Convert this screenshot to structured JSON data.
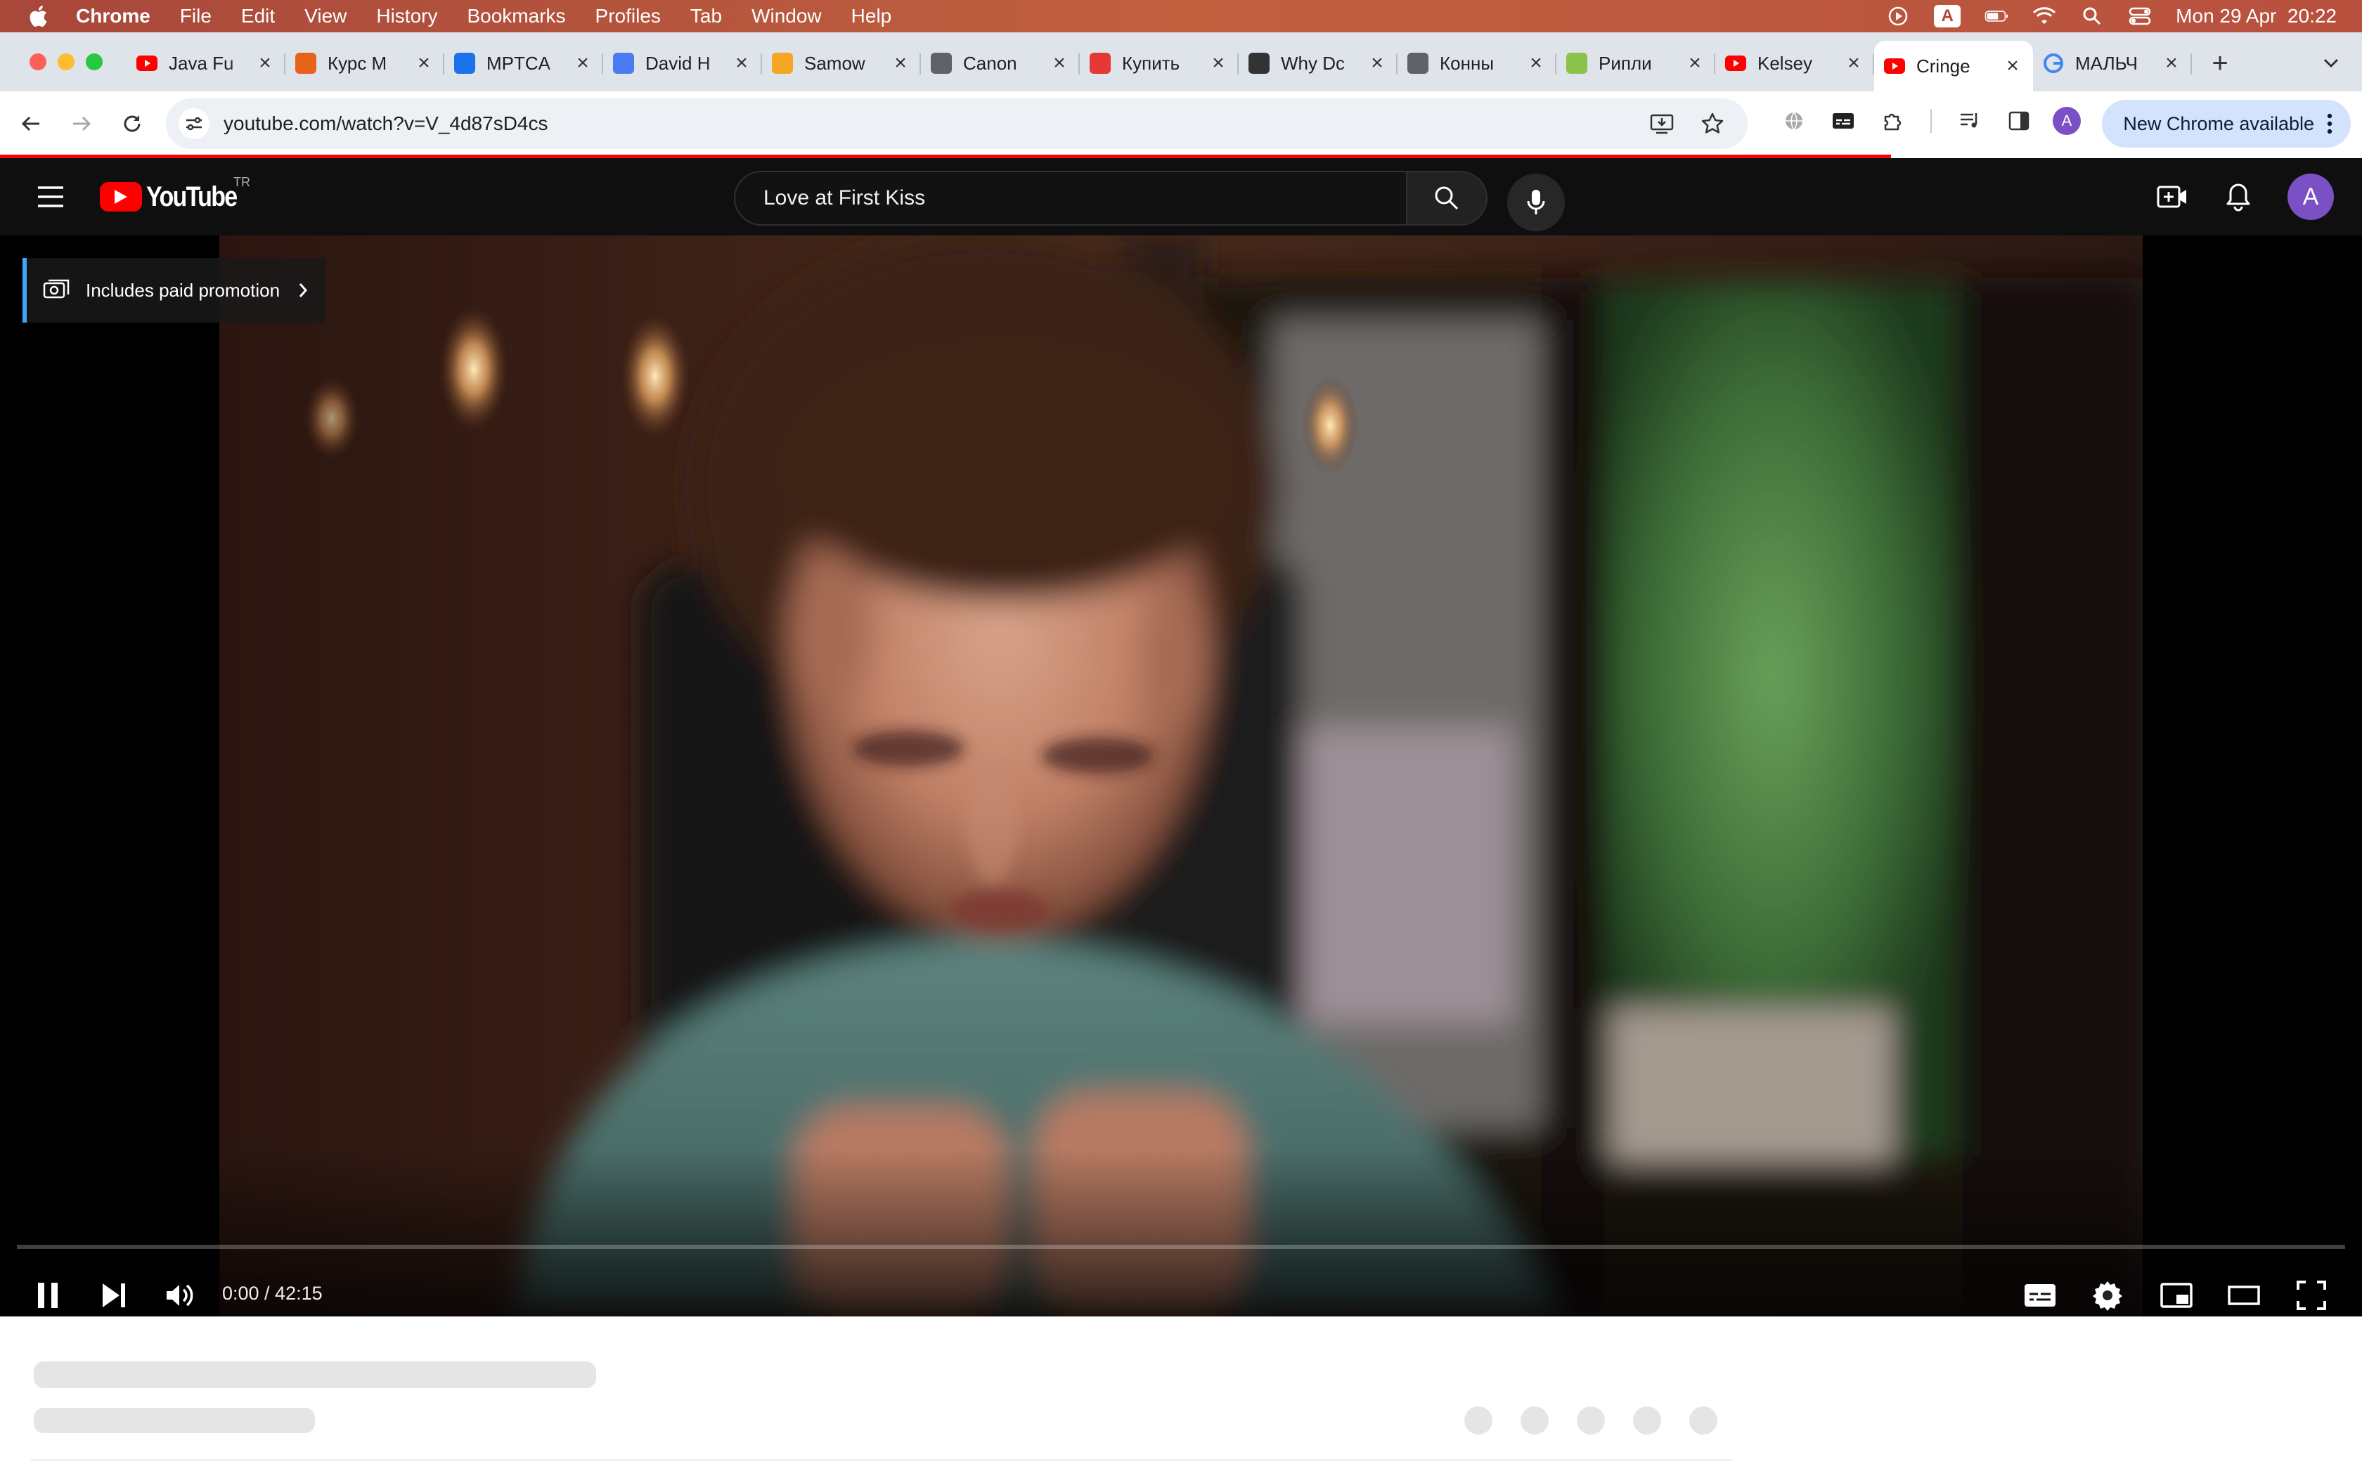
{
  "menubar": {
    "apple_icon": "apple-logo-icon",
    "items": [
      "Chrome",
      "File",
      "Edit",
      "View",
      "History",
      "Bookmarks",
      "Profiles",
      "Tab",
      "Window",
      "Help"
    ],
    "input_source": "A",
    "datetime": "Mon 29 Apr  20:22"
  },
  "tabs": [
    {
      "title": "Java Fu",
      "favicon": "youtube-icon",
      "color": "#ff0000",
      "active": false
    },
    {
      "title": "Курс M",
      "favicon": "shield-icon",
      "color": "#e8631a",
      "active": false
    },
    {
      "title": "MPTCA",
      "favicon": "wave-icon",
      "color": "#1a73e8",
      "active": false
    },
    {
      "title": "David H",
      "favicon": "doc-icon",
      "color": "#4a7bf0",
      "active": false
    },
    {
      "title": "Samow",
      "favicon": "play-arrow-icon",
      "color": "#f5a623",
      "active": false
    },
    {
      "title": "Canon",
      "favicon": "globe-icon",
      "color": "#5f6368",
      "active": false
    },
    {
      "title": "Купить",
      "favicon": "arc-icon",
      "color": "#e53935",
      "active": false
    },
    {
      "title": "Why Dc",
      "favicon": "building-icon",
      "color": "#333333",
      "active": false
    },
    {
      "title": "Конны",
      "favicon": "globe-icon",
      "color": "#5f6368",
      "active": false
    },
    {
      "title": "Рипли",
      "favicon": "hd-icon",
      "color": "#8bc34a",
      "active": false
    },
    {
      "title": "Kelsey",
      "favicon": "youtube-icon",
      "color": "#ff0000",
      "active": false
    },
    {
      "title": "Cringe",
      "favicon": "youtube-icon",
      "color": "#ff0000",
      "active": true
    },
    {
      "title": "МАЛЬЧ",
      "favicon": "google-icon",
      "color": "#4285f4",
      "active": false
    }
  ],
  "toolbar": {
    "url": "youtube.com/watch?v=V_4d87sD4cs",
    "profile_initial": "A",
    "update_label": "New Chrome available"
  },
  "youtube": {
    "logo_text": "YouTube",
    "country_code": "TR",
    "search_value": "Love at First Kiss",
    "avatar_initial": "A"
  },
  "player": {
    "promo_label": "Includes paid promotion",
    "time_display": "0:00 / 42:15",
    "progress_fraction": 0.0
  }
}
